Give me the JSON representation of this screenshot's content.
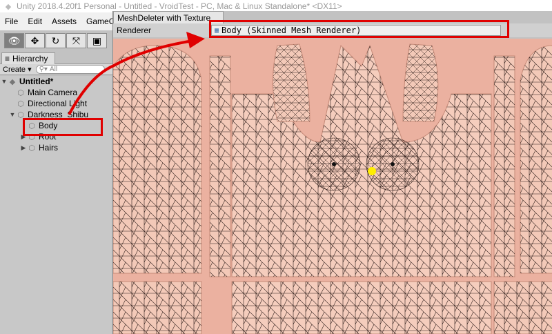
{
  "window": {
    "title": "Unity 2018.4.20f1 Personal - Untitled - VroidTest - PC, Mac & Linux Standalone* <DX11>"
  },
  "menu": [
    "File",
    "Edit",
    "Assets",
    "GameObj"
  ],
  "toolbar": [
    "hand-tool",
    "move-tool",
    "rotate-tool",
    "scale-tool",
    "rect-tool"
  ],
  "hierarchy": {
    "tab_label": "Hierarchy",
    "create_label": "Create",
    "search_placeholder": "All",
    "scene": "Untitled*",
    "items": [
      {
        "label": "Main Camera"
      },
      {
        "label": "Directional Light"
      },
      {
        "label": "Darkness_Shibu"
      },
      {
        "label": "Body"
      },
      {
        "label": "Root"
      },
      {
        "label": "Hairs"
      }
    ]
  },
  "tool_window": {
    "tab_label": "MeshDeleter with Texture",
    "renderer_label": "Renderer",
    "renderer_value": "Body (Skinned Mesh Renderer)"
  },
  "colors": {
    "skin": "#ebb1a0",
    "highlight": "#e00000",
    "marker": "#ffee00"
  }
}
